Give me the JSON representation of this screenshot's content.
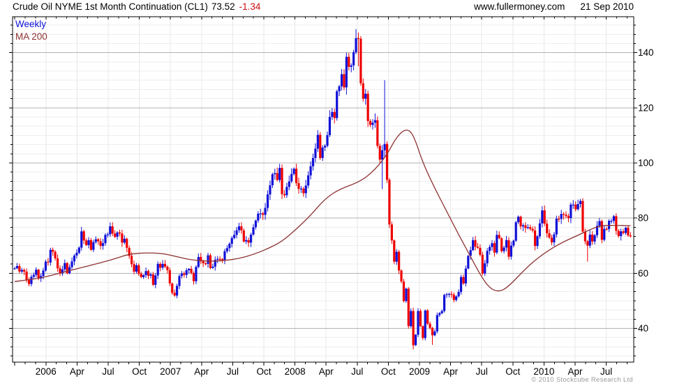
{
  "header": {
    "title": "Crude Oil NYME 1st Month Continuation (CL1)",
    "last_price": "73.52",
    "change": "-1.34",
    "website": "www.fullermoney.com",
    "date": "21 Sep 2010"
  },
  "legend": {
    "series1_label": "Weekly",
    "series2_label": "MA 200"
  },
  "footer": {
    "copyright": "© 2010 Stockcube Research Ltd"
  },
  "colors": {
    "up_candle": "#1010d8",
    "down_candle": "#ee0000",
    "ma_line": "#8f3232",
    "change_text": "#cc1111",
    "grid_minor": "#ededed",
    "grid_major": "#b3b3b3",
    "grid_vertical": "#e7e7e7",
    "axis": "#000000",
    "copyright_text": "#9a9a9a"
  },
  "chart_data": {
    "type": "candlestick",
    "frequency": "weekly",
    "overlay": "200-day moving average",
    "x_start": "Oct 2005",
    "x_end": "21 Sep 2010",
    "x_tick_labels": [
      "2006",
      "Apr",
      "Jul",
      "Oct",
      "2007",
      "Apr",
      "Jul",
      "Oct",
      "2008",
      "Apr",
      "Jul",
      "Oct",
      "2009",
      "Apr",
      "Jul",
      "Oct",
      "2010",
      "Apr",
      "Jul"
    ],
    "y_ticks": [
      40,
      60,
      80,
      100,
      120,
      140
    ],
    "ylim": [
      28,
      153
    ],
    "grid": true,
    "legend_position": "top-left",
    "first_open": 61.5,
    "weekly_closes": [
      61.8,
      62.6,
      60.6,
      61.2,
      60.6,
      57.5,
      56.1,
      58.7,
      59.4,
      61.3,
      58.1,
      59.0,
      61.0,
      64.2,
      63.9,
      68.5,
      67.8,
      65.4,
      61.8,
      59.9,
      61.4,
      63.7,
      60.0,
      62.2,
      64.3,
      66.4,
      67.4,
      69.3,
      75.2,
      71.9,
      70.2,
      72.0,
      68.5,
      71.3,
      72.3,
      71.6,
      69.9,
      70.9,
      73.9,
      74.1,
      77.0,
      74.4,
      73.2,
      74.8,
      74.4,
      71.1,
      72.5,
      69.2,
      66.3,
      63.3,
      60.6,
      62.9,
      59.8,
      58.6,
      59.3,
      60.8,
      59.1,
      59.6,
      55.8,
      59.2,
      63.4,
      62.0,
      63.4,
      62.4,
      61.1,
      56.3,
      52.9,
      51.9,
      55.4,
      59.0,
      59.9,
      59.4,
      61.1,
      61.6,
      60.1,
      57.1,
      62.3,
      65.9,
      64.3,
      63.6,
      63.4,
      66.5,
      61.9,
      62.4,
      64.9,
      65.2,
      65.1,
      64.8,
      68.0,
      69.1,
      70.7,
      72.8,
      73.9,
      75.6,
      77.0,
      75.5,
      71.5,
      72.0,
      71.1,
      74.0,
      76.7,
      79.1,
      81.6,
      81.7,
      81.2,
      83.7,
      88.6,
      91.9,
      95.9,
      96.3,
      93.8,
      98.2,
      88.7,
      88.3,
      91.3,
      93.3,
      96.0,
      97.9,
      92.7,
      90.6,
      90.7,
      89.0,
      91.8,
      95.5,
      98.8,
      101.8,
      105.2,
      110.2,
      101.8,
      105.6,
      106.2,
      110.1,
      116.7,
      118.5,
      116.3,
      126.0,
      127.8,
      132.2,
      127.4,
      138.5,
      134.9,
      135.4,
      140.2,
      145.3,
      [
        145.1,
        147.3,
        135.1
      ],
      [
        128.9,
        146.0,
        128.0
      ],
      123.3,
      125.1,
      115.2,
      113.8,
      114.6,
      115.5,
      106.2,
      101.2,
      [
        104.6,
        106.5,
        90.5
      ],
      [
        106.9,
        130.0,
        102.0
      ],
      93.9,
      77.7,
      71.9,
      64.2,
      67.8,
      61.0,
      57.0,
      49.9,
      54.4,
      40.8,
      46.3,
      [
        33.9,
        47.5,
        32.4
      ],
      37.7,
      46.3,
      40.8,
      36.5,
      46.5,
      41.7,
      40.2,
      [
        37.5,
        40.5,
        34.0
      ],
      38.9,
      44.8,
      45.5,
      46.3,
      52.1,
      52.4,
      52.5,
      52.2,
      50.3,
      51.6,
      53.2,
      58.6,
      56.3,
      61.7,
      66.3,
      68.4,
      72.0,
      69.6,
      69.2,
      66.7,
      59.9,
      63.6,
      68.1,
      69.5,
      70.9,
      67.5,
      73.9,
      72.7,
      68.0,
      69.3,
      72.0,
      66.0,
      70.0,
      71.8,
      78.5,
      80.5,
      77.0,
      77.4,
      76.4,
      76.7,
      76.1,
      75.5,
      69.9,
      73.4,
      78.1,
      82.8,
      78.0,
      74.5,
      72.9,
      71.2,
      74.1,
      79.8,
      79.7,
      81.5,
      81.2,
      80.7,
      80.0,
      84.9,
      84.9,
      83.2,
      85.1,
      86.2,
      [
        75.1,
        87.2,
        74.5
      ],
      71.6,
      [
        70.0,
        72.1,
        64.2
      ],
      74.0,
      71.5,
      73.8,
      77.2,
      78.9,
      72.1,
      76.1,
      76.0,
      79.0,
      79.0,
      80.7,
      75.4,
      73.5,
      75.2,
      74.6,
      76.5,
      73.7,
      [
        73.5,
        74.9,
        72.9
      ]
    ],
    "ma200_anchors": [
      [
        0,
        57.0
      ],
      [
        8,
        57.8
      ],
      [
        16,
        59.3
      ],
      [
        24,
        61.2
      ],
      [
        32,
        62.9
      ],
      [
        40,
        64.7
      ],
      [
        48,
        67.0
      ],
      [
        55,
        67.4
      ],
      [
        62,
        67.2
      ],
      [
        68,
        66.0
      ],
      [
        74,
        64.8
      ],
      [
        82,
        64.3
      ],
      [
        88,
        64.6
      ],
      [
        94,
        65.3
      ],
      [
        100,
        66.8
      ],
      [
        106,
        68.9
      ],
      [
        112,
        71.5
      ],
      [
        118,
        76.0
      ],
      [
        124,
        81.0
      ],
      [
        130,
        87.0
      ],
      [
        136,
        90.5
      ],
      [
        145,
        93.3
      ],
      [
        151,
        97.6
      ],
      [
        156,
        103.0
      ],
      [
        160,
        109.5
      ],
      [
        164,
        112.5
      ],
      [
        167,
        110.5
      ],
      [
        171,
        100.0
      ],
      [
        176,
        90.8
      ],
      [
        181,
        82.4
      ],
      [
        186,
        74.0
      ],
      [
        191,
        66.0
      ],
      [
        195,
        59.5
      ],
      [
        199,
        54.5
      ],
      [
        203,
        53.2
      ],
      [
        207,
        55.2
      ],
      [
        214,
        61.7
      ],
      [
        221,
        66.8
      ],
      [
        228,
        70.6
      ],
      [
        236,
        73.8
      ],
      [
        242,
        76.2
      ],
      [
        246,
        77.3
      ],
      [
        252,
        77.4
      ],
      [
        258,
        77.2
      ]
    ]
  }
}
